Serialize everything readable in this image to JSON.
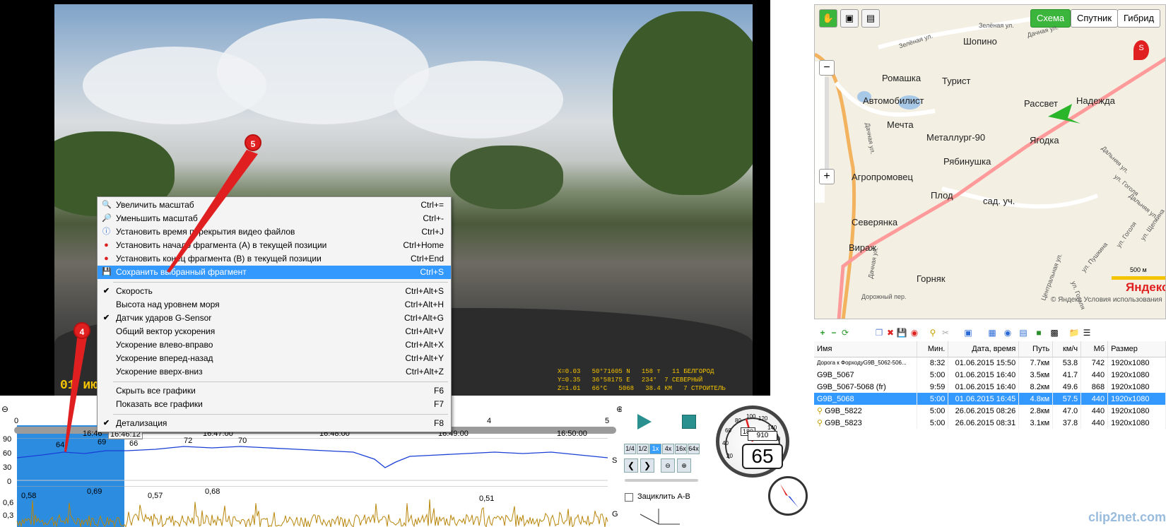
{
  "video": {
    "osd_time": "01 июн 2",
    "osd_info": "X=0.03   50°71605 N   158 т   11 БЕЛГОРОД\nY=0.35   36°58175 E   234°  7 СЕВЕРНЫЙ\nZ=1.01   66°C   5068   38.4 КМ   7 СТРОИТЕЛЬ"
  },
  "context_menu": {
    "items": [
      {
        "icon": "zoom-in-icon",
        "label": "Увеличить масштаб",
        "shortcut": "Ctrl+="
      },
      {
        "icon": "zoom-out-icon",
        "label": "Уменьшить масштаб",
        "shortcut": "Ctrl+-"
      },
      {
        "icon": "info-icon",
        "label": "Установить время перекрытия видео файлов",
        "shortcut": "Ctrl+J"
      },
      {
        "icon": "pin-icon",
        "label": "Установить начало фрагмента (A) в текущей позиции",
        "shortcut": "Ctrl+Home"
      },
      {
        "icon": "pin-icon",
        "label": "Установить конец фрагмента (B) в текущей позиции",
        "shortcut": "Ctrl+End"
      },
      {
        "icon": "floppy-icon",
        "label": "Сохранить выбранный фрагмент",
        "shortcut": "Ctrl+S"
      },
      {
        "label": "Скорость",
        "shortcut": "Ctrl+Alt+S",
        "checked": true
      },
      {
        "label": "Высота над уровнем моря",
        "shortcut": "Ctrl+Alt+H"
      },
      {
        "label": "Датчик ударов G-Sensor",
        "shortcut": "Ctrl+Alt+G",
        "checked": true
      },
      {
        "label": "Общий вектор ускорения",
        "shortcut": "Ctrl+Alt+V"
      },
      {
        "label": "Ускорение влево-вправо",
        "shortcut": "Ctrl+Alt+X"
      },
      {
        "label": "Ускорение вперед-назад",
        "shortcut": "Ctrl+Alt+Y"
      },
      {
        "label": "Ускорение вверх-вниз",
        "shortcut": "Ctrl+Alt+Z"
      },
      {
        "label": "Скрыть все графики",
        "shortcut": "F6"
      },
      {
        "label": "Показать все графики",
        "shortcut": "F7"
      },
      {
        "label": "Детализация",
        "shortcut": "F8",
        "checked": true
      }
    ]
  },
  "markers": {
    "m4": "4",
    "m5": "5"
  },
  "timeline": {
    "ticks": [
      "0",
      "4",
      "5"
    ],
    "times": [
      "16:46",
      "16:46:12",
      "16:47:00",
      "16:48:00",
      "16:49:00",
      "16:50:00"
    ],
    "speed_axis": [
      "90",
      "60",
      "30",
      "0"
    ],
    "speed_channel": "S",
    "g_axis": [
      "0,6",
      "0,3"
    ],
    "g_channel": "G",
    "speed_values": [
      "64",
      "69",
      "66",
      "72",
      "70"
    ],
    "g_values": [
      "0,58",
      "0,69",
      "0,57",
      "0,68",
      "0,51"
    ]
  },
  "player": {
    "rates": [
      "1/4",
      "1/2",
      "1x",
      "4x",
      "16x",
      "64x"
    ],
    "loop_label": "Зациклить A-B",
    "speed": "65",
    "odometer": "910",
    "speed_limit": "180",
    "dial": [
      "20",
      "40",
      "60",
      "80",
      "100",
      "120",
      "140",
      "160",
      "180",
      "200"
    ]
  },
  "map": {
    "modes": [
      "Схема",
      "Спутник",
      "Гибрид"
    ],
    "places": [
      "Шопино",
      "Ромашка",
      "Турист",
      "Автомобилист",
      "Рассвет",
      "Надежда",
      "Мечта",
      "Металлург-90",
      "Ягодка",
      "Рябинушка",
      "Агропромовец",
      "Плод",
      "сад. уч.",
      "Северянка",
      "Вираж",
      "Горняк"
    ],
    "streets": [
      "Зелёная ул.",
      "Зелёная ул.",
      "Дачная ул.",
      "Дачная ул.",
      "Дачная ул.",
      "Дорожный пер.",
      "Центральная ул.",
      "ул. Пушкина",
      "ул. Гоголя",
      "ул. Гоголя",
      "Дальняя ул.",
      "ул. Щепкина",
      "ул. Гоголя",
      "Дальняя ул."
    ],
    "scale": "500 м",
    "copyright": "© Яндекс  Условия использования",
    "logo": "Яндекс",
    "start_marker": "S"
  },
  "file_list": {
    "columns": [
      "Имя",
      "Мин.",
      "Дата, время",
      "Путь",
      "км/ч",
      "Мб",
      "Размер"
    ],
    "rows": [
      {
        "name": "Дорога к ФорходуG9B_5062-506...",
        "min": "8:32",
        "date": "01.06.2015 15:50",
        "path": "7.7км",
        "kmh": "53.8",
        "mb": "742",
        "size": "1920x1080",
        "selected": false
      },
      {
        "name": "G9B_5067",
        "min": "5:00",
        "date": "01.06.2015 16:40",
        "path": "3.5км",
        "kmh": "41.7",
        "mb": "440",
        "size": "1920x1080",
        "selected": false
      },
      {
        "name": "G9B_5067-5068 (fr)",
        "min": "9:59",
        "date": "01.06.2015 16:40",
        "path": "8.2км",
        "kmh": "49.6",
        "mb": "868",
        "size": "1920x1080",
        "selected": false
      },
      {
        "name": "G9B_5068",
        "min": "5:00",
        "date": "01.06.2015 16:45",
        "path": "4.8км",
        "kmh": "57.5",
        "mb": "440",
        "size": "1920x1080",
        "selected": true
      },
      {
        "name": "G9B_5822",
        "min": "5:00",
        "date": "26.06.2015 08:26",
        "path": "2.8км",
        "kmh": "47.0",
        "mb": "440",
        "size": "1920x1080",
        "selected": false
      },
      {
        "name": "G9B_5823",
        "min": "5:00",
        "date": "26.06.2015 08:31",
        "path": "3.1км",
        "kmh": "37.8",
        "mb": "440",
        "size": "1920x1080",
        "selected": false
      }
    ]
  },
  "watermark": "clip2net.com"
}
